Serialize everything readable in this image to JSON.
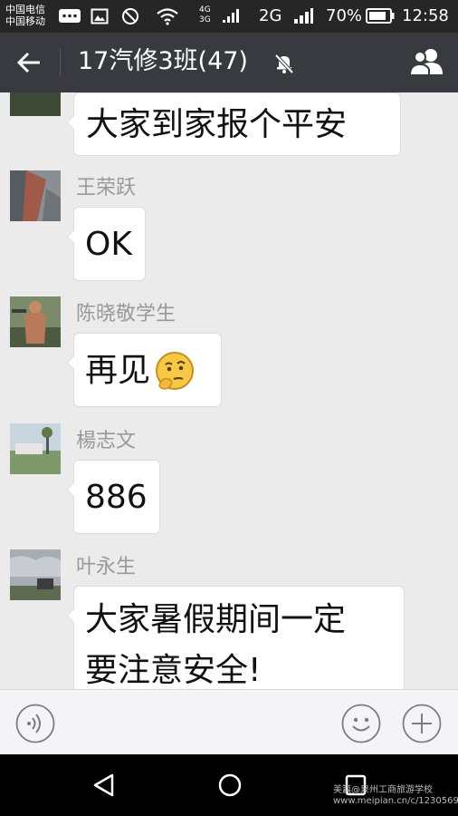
{
  "status_bar": {
    "carrier_top": "中国电信",
    "carrier_bottom": "中国移动",
    "net_4g_top": "4G",
    "net_4g_bottom": "3G",
    "network_2g": "2G",
    "battery": "70%",
    "time": "12:58"
  },
  "header": {
    "title": "17汽修3班(47)",
    "icons": [
      "back-arrow-icon",
      "mute-icon",
      "group-members-icon"
    ]
  },
  "messages": [
    {
      "sender": "",
      "text": "大家到家报个平安"
    },
    {
      "sender": "王荣跃",
      "text": "OK"
    },
    {
      "sender": "陈晓敬学生",
      "text": "再见",
      "emoji": "thinking-face-icon"
    },
    {
      "sender": "楊志文",
      "text": "886"
    },
    {
      "sender": "叶永生",
      "text_line1": "大家暑假期间一定",
      "text_line2": "要注意安全!"
    }
  ],
  "input_bar": {
    "icons": [
      "voice-icon",
      "emoji-face-icon",
      "plus-icon"
    ]
  },
  "system_nav": {
    "icons": [
      "nav-back-icon",
      "nav-home-icon",
      "nav-recents-icon"
    ]
  },
  "watermark": {
    "line1": "美篇@泉州工商旅游学校",
    "line2": "www.meipian.cn/c/1230569"
  },
  "colors": {
    "status_bar": "#262626",
    "nav_bar": "#393a3f",
    "chat_background": "#ebebeb",
    "bubble": "#ffffff",
    "sender_name": "#999999"
  }
}
